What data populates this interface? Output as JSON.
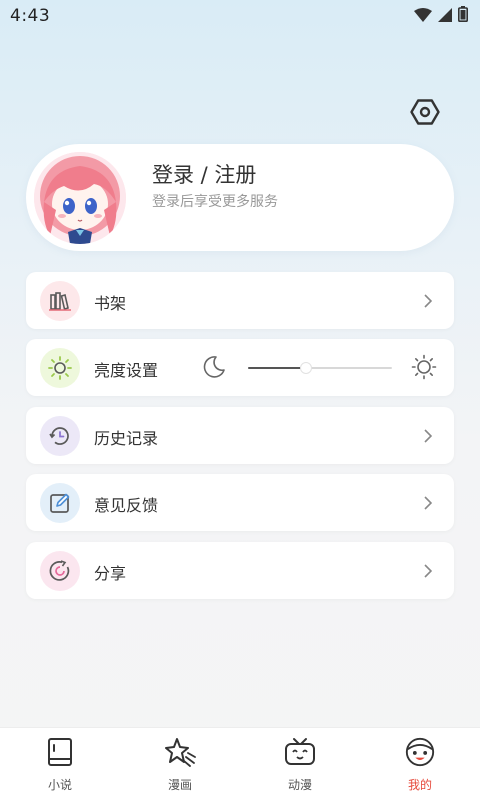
{
  "status_bar": {
    "time": "4:43"
  },
  "profile": {
    "title": "登录 / 注册",
    "subtitle": "登录后享受更多服务"
  },
  "menu": {
    "bookshelf": "书架",
    "brightness": "亮度设置",
    "history": "历史记录",
    "feedback": "意见反馈",
    "share": "分享"
  },
  "brightness": {
    "level": 0.4
  },
  "bottom_nav": {
    "items": [
      {
        "label": "小说",
        "icon": "book-icon",
        "active": false
      },
      {
        "label": "漫画",
        "icon": "star-icon",
        "active": false
      },
      {
        "label": "动漫",
        "icon": "tv-icon",
        "active": false
      },
      {
        "label": "我的",
        "icon": "profile-face-icon",
        "active": true
      }
    ]
  },
  "colors": {
    "accent": "#e64a3c",
    "bookshelf_icon_bg": "#fde8ea",
    "brightness_icon_bg": "#eef8dc",
    "history_icon_bg": "#ece8f7",
    "feedback_icon_bg": "#e3eff9",
    "share_icon_bg": "#fbe6ef"
  }
}
